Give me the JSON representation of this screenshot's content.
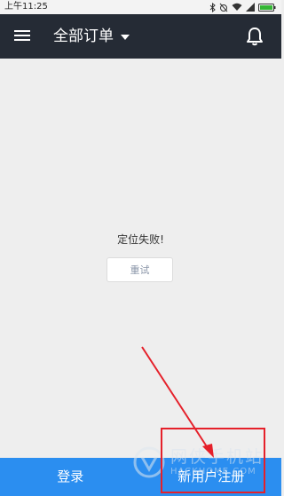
{
  "status_bar": {
    "time": "上午11:25",
    "icons": [
      "bluetooth-icon",
      "alarm-off-icon",
      "wifi-icon",
      "signal-icon",
      "battery-icon"
    ],
    "battery_color": "#35b635"
  },
  "app_bar": {
    "title": "全部订单",
    "background": "#252b35",
    "icons": [
      "menu-icon",
      "caret-down-icon",
      "bell-icon"
    ]
  },
  "main": {
    "error_message": "定位失败!",
    "retry_label": "重试"
  },
  "bottom_bar": {
    "login_label": "登录",
    "register_label": "新用户注册",
    "background": "#2b8ef0"
  },
  "annotation": {
    "color": "#e5202a"
  },
  "watermark": {
    "text": "网侠手机站",
    "subtext": "HACKHOME.COM"
  }
}
